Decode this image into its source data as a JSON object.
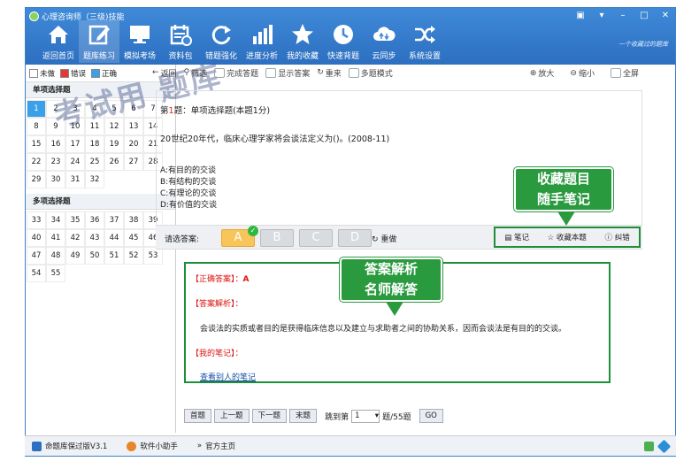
{
  "window": {
    "title": "心理咨询师（三级)技能",
    "tagline": "一个收藏过的题库"
  },
  "nav": [
    {
      "label": "返回首页",
      "icon": "home-icon"
    },
    {
      "label": "题库练习",
      "icon": "edit-icon"
    },
    {
      "label": "模拟考场",
      "icon": "monitor-icon"
    },
    {
      "label": "资料包",
      "icon": "calendar-icon"
    },
    {
      "label": "错题强化",
      "icon": "refresh-icon"
    },
    {
      "label": "进度分析",
      "icon": "bar-chart-icon"
    },
    {
      "label": "我的收藏",
      "icon": "star-icon"
    },
    {
      "label": "快速背题",
      "icon": "clock-icon"
    },
    {
      "label": "云同步",
      "icon": "cloud-icon"
    },
    {
      "label": "系统设置",
      "icon": "shuffle-icon"
    }
  ],
  "legend": {
    "undone": "未做",
    "wrong": "错误",
    "right": "正确",
    "colors": {
      "undone": "#ffffff",
      "wrong": "#e53935",
      "right": "#3aa0e8"
    }
  },
  "left": {
    "single_header": "单项选择题",
    "multi_header": "多项选择题",
    "single": [
      "1",
      "2",
      "3",
      "4",
      "5",
      "6",
      "7",
      "8",
      "9",
      "10",
      "11",
      "12",
      "13",
      "14",
      "15",
      "16",
      "17",
      "18",
      "19",
      "20",
      "21",
      "22",
      "23",
      "24",
      "25",
      "26",
      "27",
      "28",
      "29",
      "30",
      "31",
      "32"
    ],
    "multi": [
      "33",
      "34",
      "35",
      "36",
      "37",
      "38",
      "39",
      "40",
      "41",
      "42",
      "43",
      "44",
      "45",
      "46",
      "47",
      "48",
      "49",
      "50",
      "51",
      "52",
      "53",
      "54",
      "55"
    ]
  },
  "toolbar": {
    "back": "返回",
    "filter": "筛选",
    "done": "完成答题",
    "show": "显示答案",
    "redo": "重来",
    "multi": "多题模式",
    "zoom_in": "放大",
    "zoom_out": "缩小",
    "full": "全屏"
  },
  "question": {
    "prefix": "第",
    "num": "1",
    "suffix": "题：单项选择题(本题1分)",
    "stem": "20世纪20年代，临床心理学家将会谈法定义为()。(2008-11)",
    "options": [
      "A:有目的的交谈",
      "B:有结构的交谈",
      "C:有理论的交谈",
      "D:有价值的交谈"
    ]
  },
  "answer_bar": {
    "label": "请选答案:",
    "choices": [
      "A",
      "B",
      "C",
      "D"
    ],
    "redo": "重做",
    "note": "笔记",
    "fav": "收藏本题",
    "report": "纠错"
  },
  "callouts": {
    "c1_line1": "收藏题目",
    "c1_line2": "随手笔记",
    "c2_line1": "答案解析",
    "c2_line2": "名师解答"
  },
  "analysis": {
    "correct_label": "【正确答案】：",
    "correct": "A",
    "analysis_label": "【答案解析】：",
    "text": "会谈法的实质或者目的是获得临床信息以及建立与求助者之间的协助关系，因而会谈法是有目的的交谈。",
    "note_label": "【我的笔记】：",
    "others": "查看别人的笔记"
  },
  "pager": {
    "first": "首题",
    "prev": "上一题",
    "next": "下一题",
    "last": "末题",
    "jump": "跳到第",
    "value": "1",
    "total": "题/55题",
    "go": "GO"
  },
  "status": {
    "edition": "命题库保过版V3.1",
    "helper": "软件小助手",
    "home": "官方主页"
  },
  "watermark": "考试用 题库"
}
